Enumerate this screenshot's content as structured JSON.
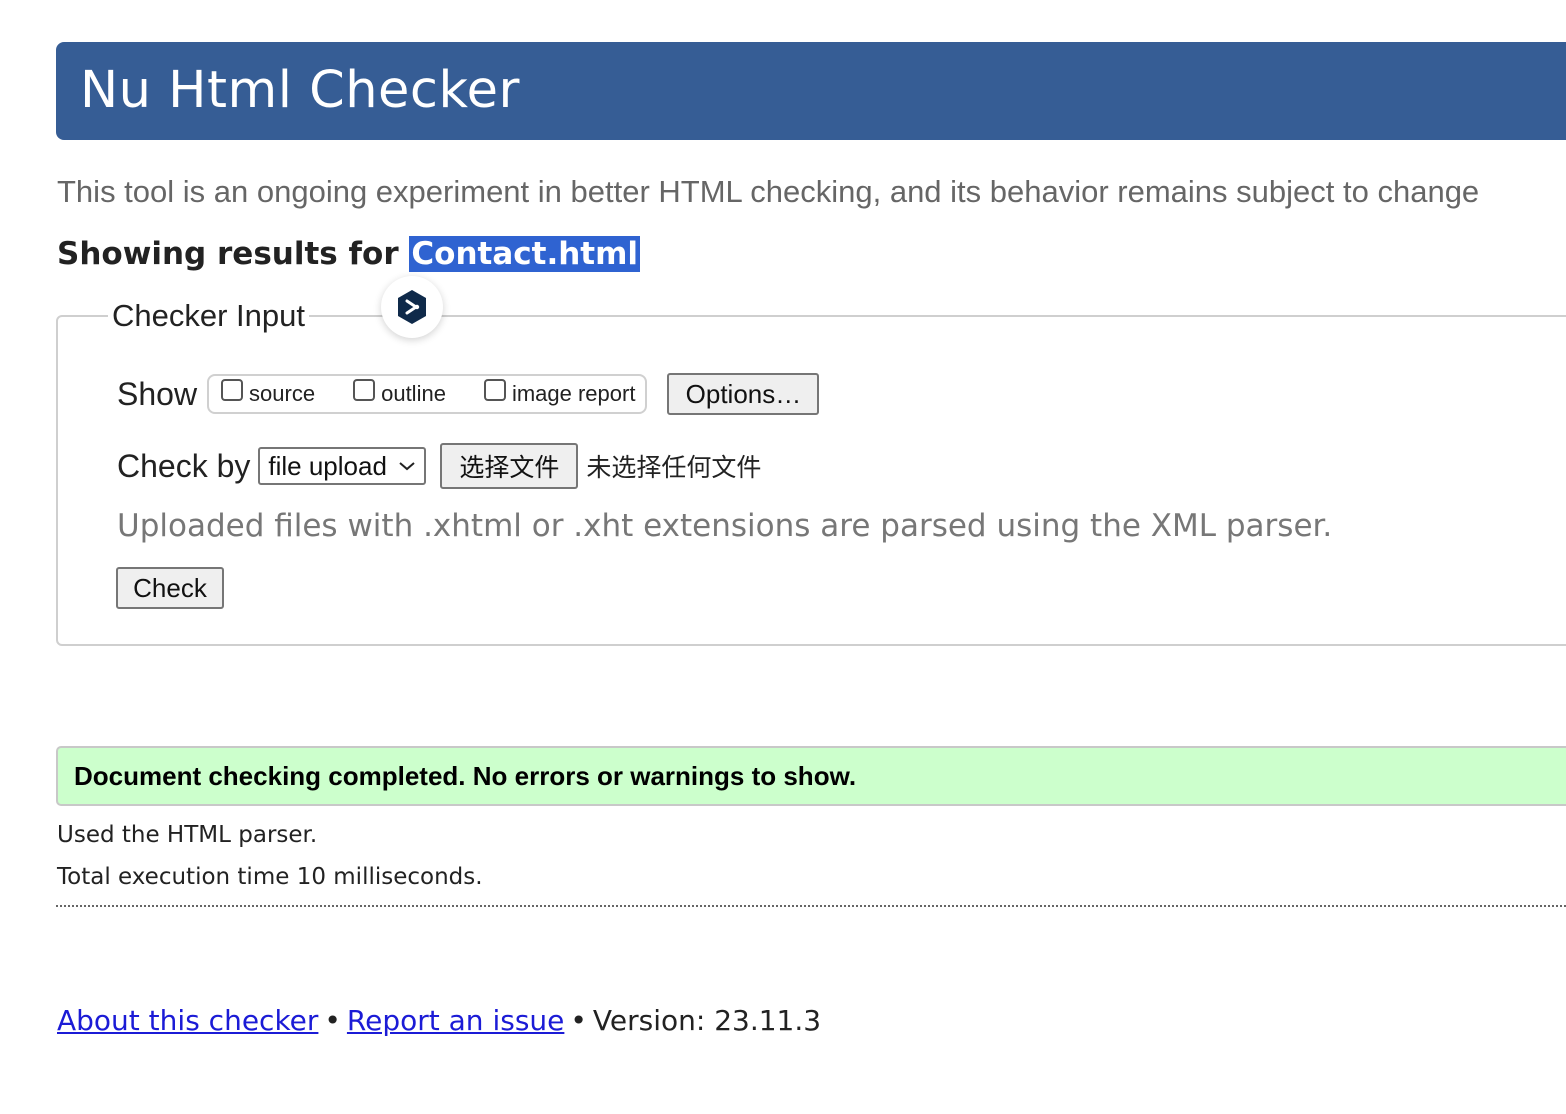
{
  "header": {
    "title": "Nu Html Checker"
  },
  "intro": "This tool is an ongoing experiment in better HTML checking, and its behavior remains subject to change",
  "results": {
    "prefix": "Showing results for",
    "filename": "Contact.html"
  },
  "checker_input": {
    "legend": "Checker Input",
    "show_label": "Show",
    "show_options": [
      {
        "label": "source",
        "checked": false
      },
      {
        "label": "outline",
        "checked": false
      },
      {
        "label": "image report",
        "checked": false
      }
    ],
    "options_button": "Options…",
    "check_by_label": "Check by",
    "check_by_selected": "file upload",
    "file_button": "选择文件",
    "no_file_text": "未选择任何文件",
    "hint": "Uploaded files with .xhtml or .xht extensions are parsed using the XML parser.",
    "check_button": "Check"
  },
  "status": {
    "success_message": "Document checking completed. No errors or warnings to show.",
    "parser_info": "Used the HTML parser.",
    "execution_time": "Total execution time 10 milliseconds."
  },
  "footer": {
    "about_link": "About this checker",
    "separator": "•",
    "report_link": "Report an issue",
    "version": "Version: 23.11.3"
  },
  "colors": {
    "header_bg": "#365d95",
    "success_bg": "#ccffcc",
    "selection_bg": "#2f63d1",
    "link": "#1b1bd6"
  }
}
